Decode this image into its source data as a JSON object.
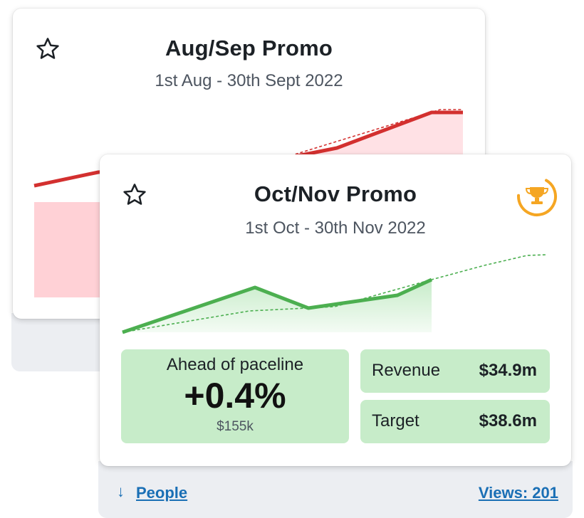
{
  "cards": {
    "back": {
      "title": "Aug/Sep Promo",
      "date_range": "1st Aug - 30th Sept 2022",
      "status_color": "#d3302f",
      "fill_color": "#ffd1d6"
    },
    "front": {
      "title": "Oct/Nov Promo",
      "date_range": "1st Oct - 30th Nov 2022",
      "status_color": "#4caf50",
      "fill_color": "#c7ecc9",
      "trophy_color": "#f5a623",
      "pace": {
        "label": "Ahead of paceline",
        "value": "+0.4%",
        "sub": "$155k"
      },
      "revenue": {
        "label": "Revenue",
        "value": "$34.9m"
      },
      "target": {
        "label": "Target",
        "value": "$38.6m"
      }
    }
  },
  "footer": {
    "people_link": "People",
    "views_link": "Views: 201"
  },
  "icons": {
    "star": "star-outline-icon",
    "trophy": "trophy-icon",
    "arrow": "arrow-down-icon"
  }
}
